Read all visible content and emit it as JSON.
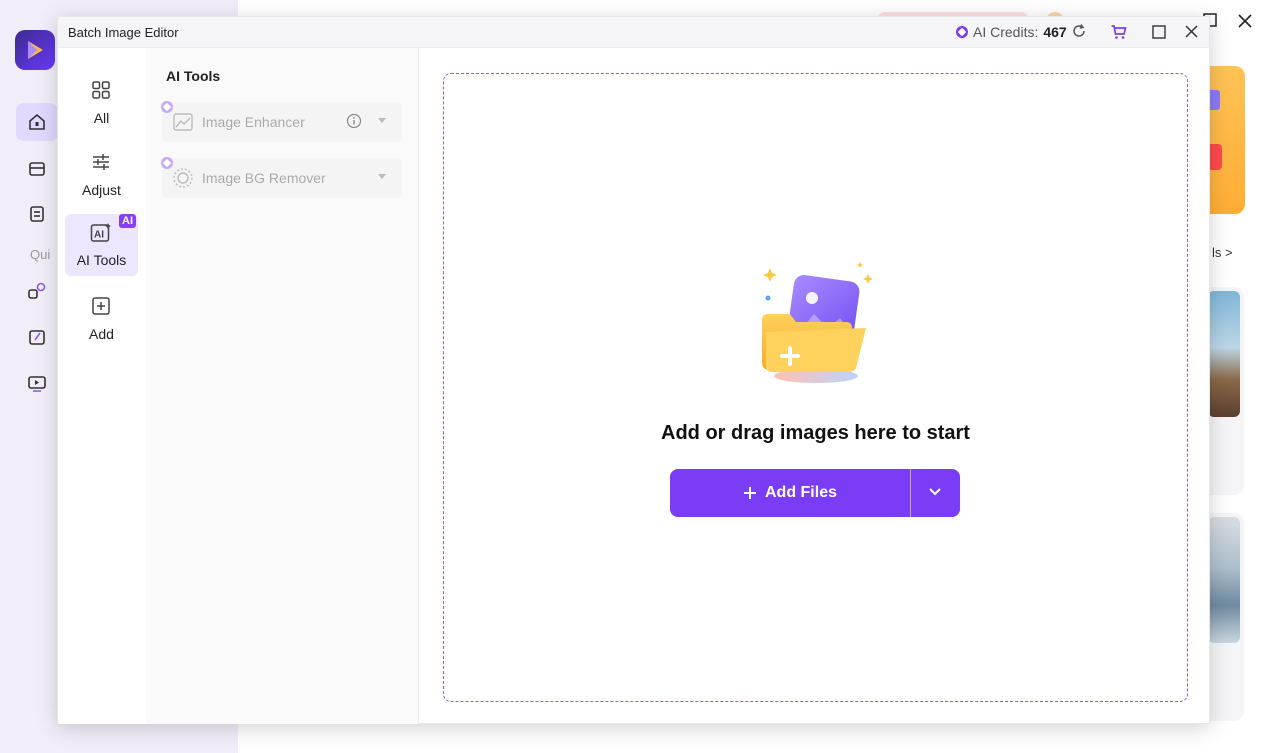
{
  "background": {
    "quick_label": "Qui",
    "tools_link": "ls >"
  },
  "window": {
    "title": "Batch Image Editor",
    "credits_label": "AI Credits:",
    "credits_value": "467"
  },
  "rail": {
    "items": [
      {
        "label": "All",
        "icon": "grid-icon"
      },
      {
        "label": "Adjust",
        "icon": "sliders-icon"
      },
      {
        "label": "AI Tools",
        "icon": "ai-icon",
        "badge": "AI",
        "active": true
      },
      {
        "label": "Add",
        "icon": "plus-square-icon"
      }
    ]
  },
  "panel": {
    "title": "AI Tools",
    "tools": [
      {
        "name": "Image Enhancer",
        "icon": "enhance-icon",
        "has_info": true
      },
      {
        "name": "Image BG Remover",
        "icon": "bg-remove-icon",
        "has_info": false
      }
    ]
  },
  "dropzone": {
    "message": "Add or drag images here to start",
    "add_files_label": "Add Files"
  },
  "colors": {
    "accent": "#7a3cf5",
    "active_bg": "#ede6ff",
    "badge": "#8a3ff2"
  }
}
